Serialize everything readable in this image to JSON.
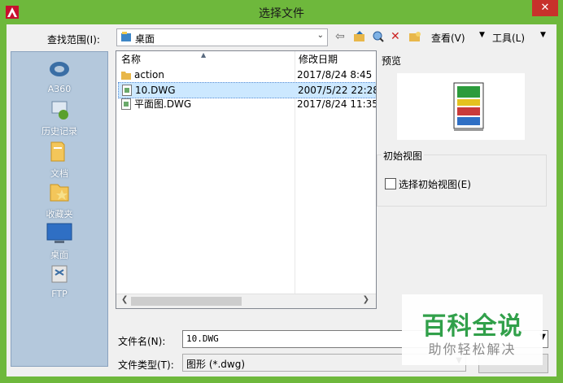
{
  "window": {
    "title": "选择文件",
    "close_glyph": "✕",
    "accent": "#6eb83c"
  },
  "lookin": {
    "label": "查找范围(I):",
    "value": "桌面"
  },
  "toolbar": {
    "view_label": "查看(V)",
    "tools_label": "工具(L)"
  },
  "places": [
    {
      "label": "A360",
      "icon": "a360-icon"
    },
    {
      "label": "历史记录",
      "icon": "history-icon"
    },
    {
      "label": "文档",
      "icon": "documents-icon"
    },
    {
      "label": "收藏夹",
      "icon": "favorites-icon"
    },
    {
      "label": "桌面",
      "icon": "desktop-icon"
    },
    {
      "label": "FTP",
      "icon": "ftp-icon"
    }
  ],
  "filelist": {
    "col_name": "名称",
    "col_date": "修改日期",
    "rows": [
      {
        "name": "action",
        "date": "2017/8/24 8:45",
        "type": "folder"
      },
      {
        "name": "10.DWG",
        "date": "2007/5/22 22:28",
        "type": "dwg"
      },
      {
        "name": "平面图.DWG",
        "date": "2017/8/24 11:35",
        "type": "dwg"
      }
    ]
  },
  "preview": {
    "label": "预览"
  },
  "initial_view": {
    "group_label": "初始视图",
    "checkbox_label": "选择初始视图(E)"
  },
  "filename": {
    "label": "文件名(N):",
    "value": "10.DWG"
  },
  "filetype": {
    "label": "文件类型(T):",
    "value": "图形 (*.dwg)"
  },
  "watermark": {
    "title": "百科全说",
    "subtitle": "助你轻松解决"
  }
}
